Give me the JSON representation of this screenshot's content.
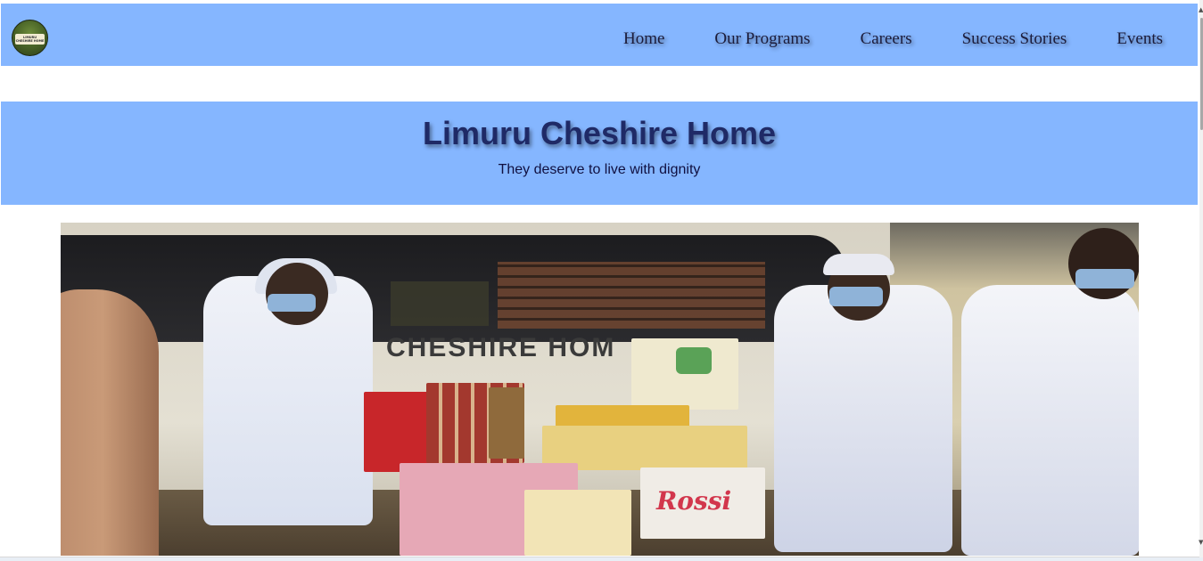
{
  "nav": {
    "logo_lines": [
      "LIMURU",
      "CHESHIRE HOME"
    ],
    "links": [
      "Home",
      "Our Programs",
      "Careers",
      "Success Stories",
      "Events"
    ]
  },
  "hero": {
    "title": "Limuru Cheshire Home",
    "tagline": "They deserve to live with dignity"
  },
  "photo": {
    "van_lettering": "CHESHIRE HOM",
    "box_brand": "Rossi"
  },
  "scrollbar": {
    "up_arrow": "▲",
    "down_arrow": "▼"
  },
  "colors": {
    "nav_bg": "#85b6ff",
    "hero_bg": "#85b6ff",
    "title_text": "#1f2a66"
  }
}
